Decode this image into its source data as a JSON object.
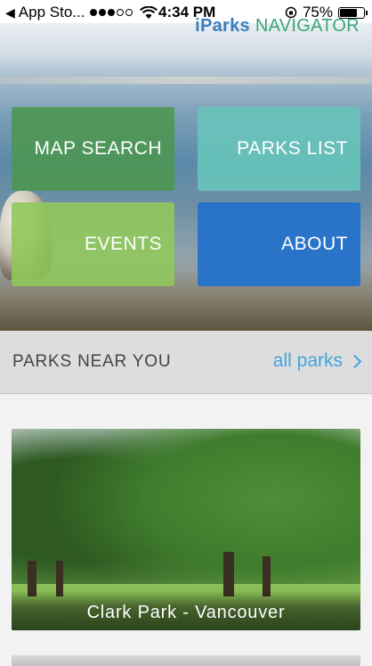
{
  "status_bar": {
    "back_app": "App Sto...",
    "time": "4:34 PM",
    "battery": "75%",
    "battery_level": 0.75,
    "signal_bars_filled": 3,
    "signal_bars_total": 5
  },
  "header": {
    "logo_prefix": "iParks",
    "logo_suffix": "NAVIGATOR"
  },
  "tiles": {
    "map_search": "MAP SEARCH",
    "parks_list": "PARKS LIST",
    "events": "EVENTS",
    "about": "ABOUT"
  },
  "nearby": {
    "title": "PARKS NEAR YOU",
    "link": "all parks"
  },
  "parks": [
    {
      "name": "Clark Park - Vancouver"
    }
  ],
  "colors": {
    "map_search": "#4C9650",
    "parks_list": "#68C4BA",
    "events": "#90C85C",
    "about": "#2472CA",
    "link": "#41A3E0"
  }
}
